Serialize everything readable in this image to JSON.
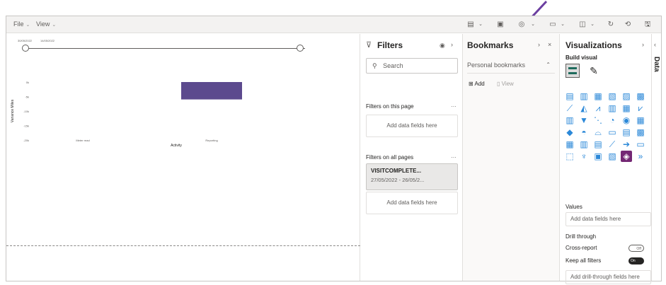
{
  "menu": {
    "file": "File",
    "view": "View"
  },
  "canvas": {
    "date_start": "30/05/2022",
    "date_end": "14/05/2022",
    "y_axis_label": "Variance Miles",
    "x_axis_label": "Activity",
    "y_ticks": [
      "0k",
      "-5k",
      "-10k",
      "-15k",
      "-20k"
    ],
    "categories": [
      "Meter read",
      "Reporting"
    ]
  },
  "chart_data": {
    "type": "bar",
    "categories": [
      "Meter read",
      "Reporting"
    ],
    "values": [
      0,
      -6
    ],
    "xlabel": "Activity",
    "ylabel": "Variance Miles",
    "ylim": [
      -20,
      0
    ]
  },
  "filters": {
    "title": "Filters",
    "search_placeholder": "Search",
    "on_this_page": "Filters on this page",
    "on_all_pages": "Filters on all pages",
    "add_data_fields": "Add data fields here",
    "card_name": "VISITCOMPLETE...",
    "card_range": "27/05/2022 - 26/05/2..."
  },
  "bookmarks": {
    "title": "Bookmarks",
    "personal": "Personal bookmarks",
    "add": "Add",
    "view": "View"
  },
  "visualizations": {
    "title": "Visualizations",
    "build_visual": "Build visual",
    "values": "Values",
    "values_zone": "Add data fields here",
    "drill_through": "Drill through",
    "cross_report": "Cross-report",
    "cross_report_state": "Off",
    "keep_all_filters": "Keep all filters",
    "keep_all_filters_state": "On",
    "drill_zone": "Add drill-through fields here"
  },
  "data_tab": {
    "label": "Data"
  },
  "colors": {
    "bar": "#5c4a8e",
    "arrow": "#6b3fa0",
    "accent": "#2b88d8"
  }
}
